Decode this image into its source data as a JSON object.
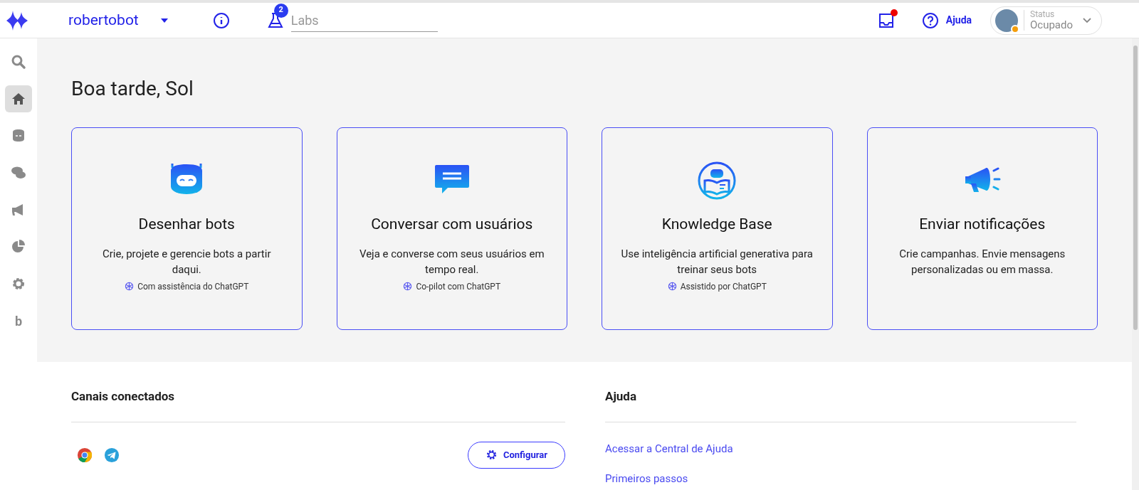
{
  "header": {
    "bot_name": "robertobot",
    "labs_badge": "2",
    "labs_placeholder": "Labs",
    "inbox_unread": true,
    "help_label": "Ajuda",
    "status_label": "Status",
    "status_value": "Ocupado"
  },
  "sidebar": {
    "items": [
      {
        "kind": "search",
        "selected": false
      },
      {
        "kind": "home",
        "selected": true
      },
      {
        "kind": "bot",
        "selected": false
      },
      {
        "kind": "chat",
        "selected": false
      },
      {
        "kind": "megaphone",
        "selected": false
      },
      {
        "kind": "chart",
        "selected": false
      },
      {
        "kind": "settings",
        "selected": false
      },
      {
        "kind": "letter",
        "label": "b",
        "selected": false
      }
    ]
  },
  "greeting": "Boa tarde, Sol",
  "cards": [
    {
      "kind": "bot",
      "title": "Desenhar bots",
      "description": "Crie, projete e gerencie bots a partir daqui.",
      "note": "Com assistência do ChatGPT"
    },
    {
      "kind": "chat",
      "title": "Conversar com usuários",
      "description": "Veja e converse com seus usuários em tempo real.",
      "note": "Co-pilot com ChatGPT"
    },
    {
      "kind": "book",
      "title": "Knowledge Base",
      "description": "Use inteligência artificial generativa para treinar seus bots",
      "note": "Assistido por ChatGPT"
    },
    {
      "kind": "megaphone",
      "title": "Enviar notificações",
      "description": "Crie campanhas. Envie mensagens personalizadas ou em massa."
    }
  ],
  "channels": {
    "title": "Canais conectados",
    "items": [
      {
        "kind": "chrome"
      },
      {
        "kind": "telegram"
      }
    ],
    "button": "Configurar"
  },
  "help": {
    "title": "Ajuda",
    "links": [
      "Acessar a Central de Ajuda",
      "Primeiros passos"
    ]
  }
}
